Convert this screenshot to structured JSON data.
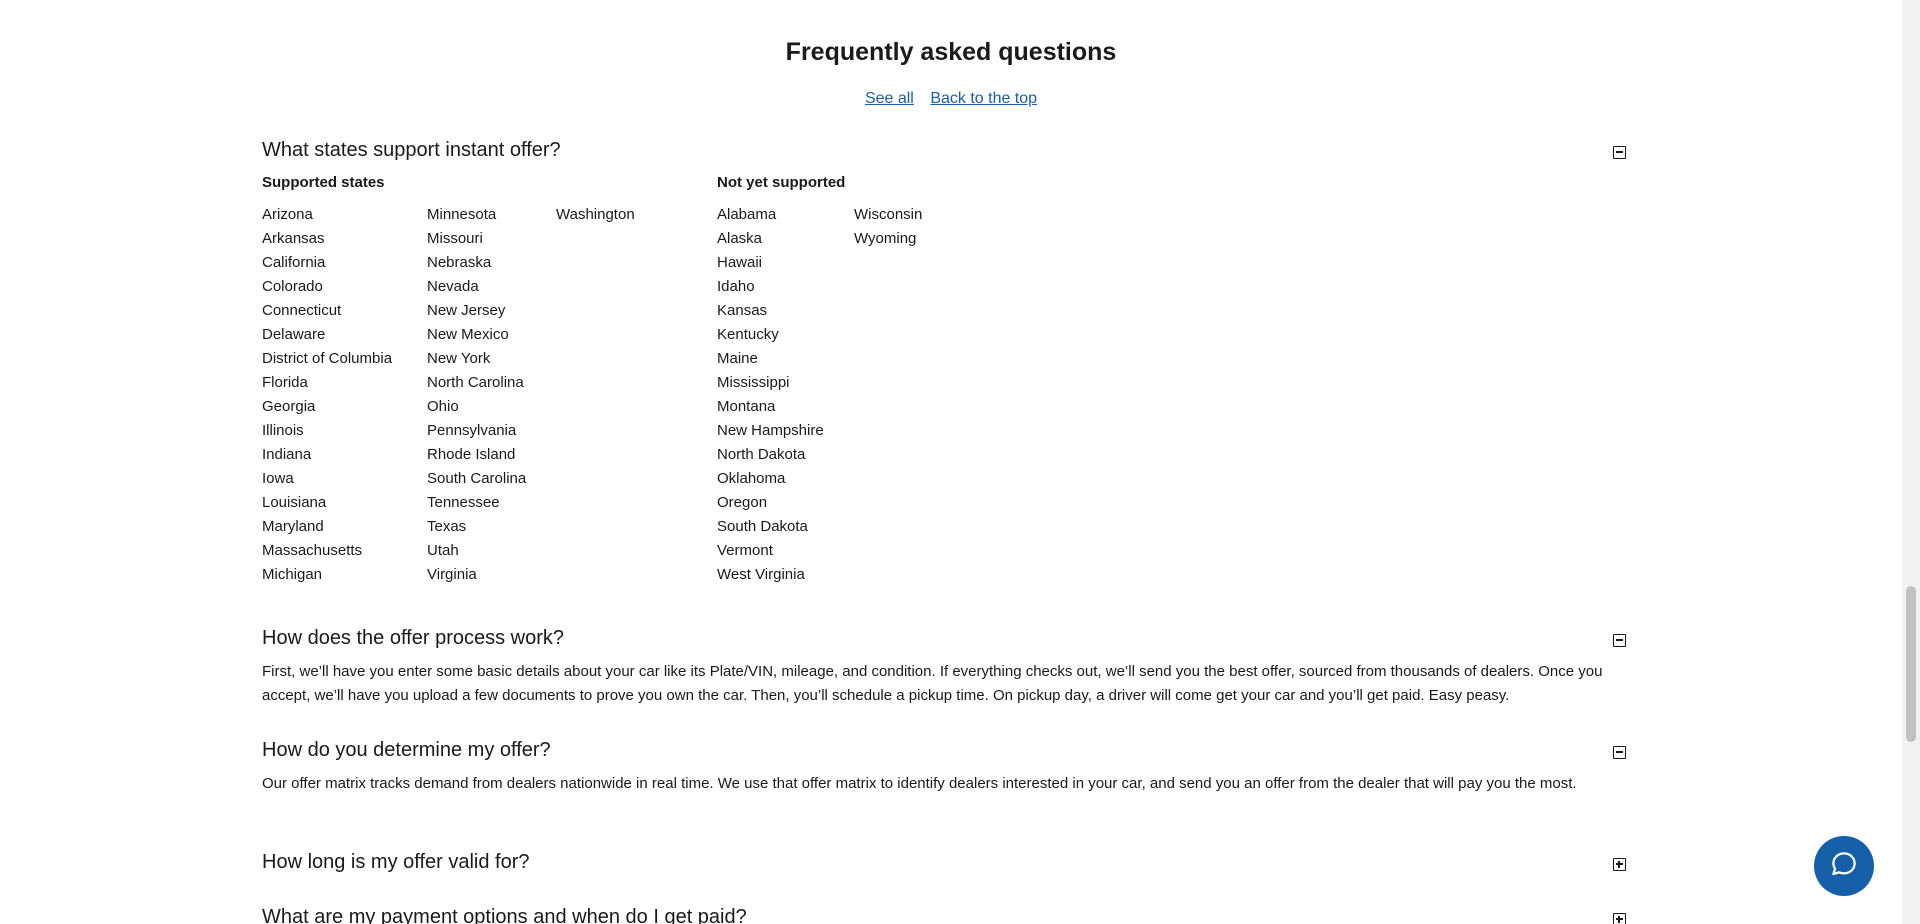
{
  "faq": {
    "title": "Frequently asked questions",
    "see_all": "See all",
    "back_to_top": "Back to the top"
  },
  "questions": [
    {
      "title": "What states support instant offer?",
      "state": "expanded",
      "supported_heading": "Supported states",
      "not_supported_heading": "Not yet supported",
      "supported_columns": [
        [
          "Arizona",
          "Arkansas",
          "California",
          "Colorado",
          "Connecticut",
          "Delaware",
          "District of Columbia",
          "Florida",
          "Georgia",
          "Illinois",
          "Indiana",
          "Iowa",
          "Louisiana",
          "Maryland",
          "Massachusetts",
          "Michigan"
        ],
        [
          "Minnesota",
          "Missouri",
          "Nebraska",
          "Nevada",
          "New Jersey",
          "New Mexico",
          "New York",
          "North Carolina",
          "Ohio",
          "Pennsylvania",
          "Rhode Island",
          "South Carolina",
          "Tennessee",
          "Texas",
          "Utah",
          "Virginia"
        ],
        [
          "Washington"
        ]
      ],
      "not_supported_columns": [
        [
          "Alabama",
          "Alaska",
          "Hawaii",
          "Idaho",
          "Kansas",
          "Kentucky",
          "Maine",
          "Mississippi",
          "Montana",
          "New Hampshire",
          "North Dakota",
          "Oklahoma",
          "Oregon",
          "South Dakota",
          "Vermont",
          "West Virginia"
        ],
        [
          "Wisconsin",
          "Wyoming"
        ]
      ]
    },
    {
      "title": "How does the offer process work?",
      "state": "expanded",
      "answer": "First, we’ll have you enter some basic details about your car like its Plate/VIN, mileage, and condition. If everything checks out, we’ll send you the best offer, sourced from thousands of dealers. Once you accept, we’ll have you upload a few documents to prove you own the car. Then, you’ll schedule a pickup time. On pickup day, a driver will come get your car and you’ll get paid. Easy peasy."
    },
    {
      "title": "How do you determine my offer?",
      "state": "expanded",
      "answer": "Our offer matrix tracks demand from dealers nationwide in real time. We use that offer matrix to identify dealers interested in your car, and send you an offer from the dealer that will pay you the most."
    },
    {
      "title": "How long is my offer valid for?",
      "state": "collapsed"
    },
    {
      "title": "What are my payment options and when do I get paid?",
      "state": "collapsed"
    }
  ],
  "colors": {
    "link": "#1b5ea8",
    "chat_button": "#1560a8",
    "text": "#1a1a1a"
  },
  "icons": {
    "expanded": "minus-square-icon",
    "collapsed": "plus-square-icon",
    "chat": "chat-bubble-icon"
  }
}
